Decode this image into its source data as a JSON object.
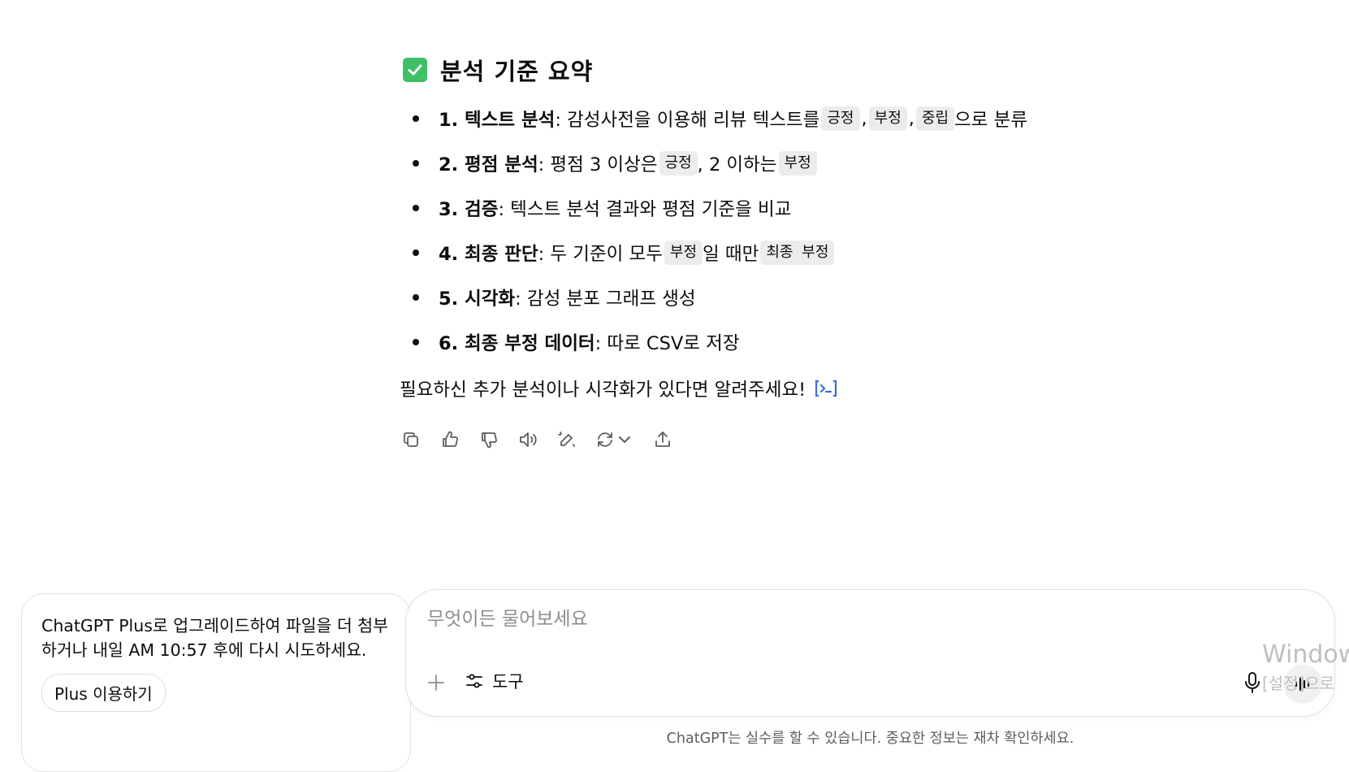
{
  "summary": {
    "check_icon": "check-square-icon",
    "heading": "분석 기준 요약",
    "items": [
      {
        "bold": "1. 텍스트 분석",
        "text": ": 감성사전을 이용해 리뷰 텍스트를 ",
        "codes": [
          "긍정",
          "부정",
          "중립"
        ],
        "sep": ",",
        "tail": "으로 분류"
      },
      {
        "bold": "2. 평점 분석",
        "text": ": 평점 3 이상은 ",
        "code1": "긍정",
        "mid": ", 2 이하는 ",
        "code2": "부정"
      },
      {
        "bold": "3. 검증",
        "text": ": 텍스트 분석 결과와 평점 기준을 비교"
      },
      {
        "bold": "4. 최종 판단",
        "text": ": 두 기준이 모두 ",
        "code1": "부정",
        "mid": "일 때만 ",
        "code2": "최종 부정"
      },
      {
        "bold": "5. 시각화",
        "text": ": 감성 분포 그래프 생성"
      },
      {
        "bold": "6. 최종 부정 데이터",
        "text": ": 따로 CSV로 저장"
      }
    ],
    "followup": "필요하신 추가 분석이나 시각화가 있다면 알려주세요!"
  },
  "actions": [
    "copy-icon",
    "thumbs-up-icon",
    "thumbs-down-icon",
    "read-aloud-icon",
    "edit-icon",
    "regenerate-icon",
    "share-icon"
  ],
  "upgrade": {
    "text": "ChatGPT Plus로 업그레이드하여 파일을 더 첨부하거나 내일 AM 10:57 후에 다시 시도하세요.",
    "button": "Plus 이용하기"
  },
  "composer": {
    "placeholder": "무엇이든 물어보세요",
    "tools_label": "도구"
  },
  "watermark": {
    "line1": "Window",
    "line2": "[설정]으로"
  },
  "disclaimer": "ChatGPT는 실수를 할 수 있습니다. 중요한 정보는 재차 확인하세요.",
  "colors": {
    "check": "#3fbf68",
    "code_bg": "#ececec",
    "link": "#3a6fd8"
  }
}
